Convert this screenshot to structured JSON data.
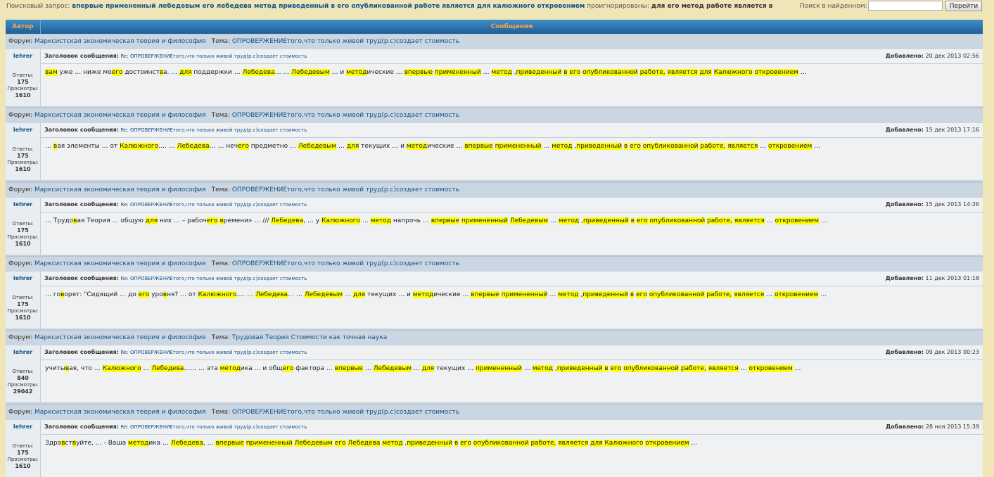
{
  "search": {
    "label": "Поисковый запрос:",
    "query": "впервые примененный лебедевым его лебедева метод приведенный в его опубликованной работе является для калюжного откровением",
    "ignored_label": "проигнорированы:",
    "ignored_words": "для его метод работе является в",
    "find_label": "Поиск в найденном:",
    "find_value": "",
    "go_label": "Перейти"
  },
  "columns": {
    "author": "Автор",
    "message": "Сообщение"
  },
  "labels": {
    "forum": "Форум:",
    "topic": "Тема:",
    "subject": "Заголовок сообщения:",
    "added": "Добавлено:",
    "replies": "Ответы:",
    "views": "Просмотры:"
  },
  "results": [
    {
      "forum": "Марксистская экономическая теория и философия",
      "topic": "ОПРОВЕРЖЕНИЕтого,что только живой труд(р.с)создает стоимость",
      "author": "lehrer",
      "replies": "175",
      "views": "1610",
      "subject": "Re: ОПРОВЕРЖЕНИЕтого,что только живой труд(р.с)создает стоимость",
      "date": "20 дек 2013 02:56",
      "body": [
        {
          "t": "вам",
          "h": true
        },
        {
          "t": " уже … ниже мо"
        },
        {
          "t": "его",
          "h": true
        },
        {
          "t": " достоинст"
        },
        {
          "t": "в",
          "h": true
        },
        {
          "t": "а. … "
        },
        {
          "t": "для",
          "h": true
        },
        {
          "t": " поддержки … "
        },
        {
          "t": "Лебедева",
          "h": true
        },
        {
          "t": "… … "
        },
        {
          "t": "Лебедевым",
          "h": true
        },
        {
          "t": " … и "
        },
        {
          "t": "метод",
          "h": true
        },
        {
          "t": "ические … "
        },
        {
          "t": "впервые",
          "h": true
        },
        {
          "t": " "
        },
        {
          "t": "примененный",
          "h": true
        },
        {
          "t": " … "
        },
        {
          "t": "метод",
          "h": true
        },
        {
          "t": " ,"
        },
        {
          "t": "приведенный",
          "h": true
        },
        {
          "t": " "
        },
        {
          "t": "в",
          "h": true
        },
        {
          "t": " "
        },
        {
          "t": "его",
          "h": true
        },
        {
          "t": " "
        },
        {
          "t": "опубликованной",
          "h": true
        },
        {
          "t": " "
        },
        {
          "t": "работе,",
          "h": true
        },
        {
          "t": " "
        },
        {
          "t": "является",
          "h": true
        },
        {
          "t": " "
        },
        {
          "t": "для",
          "h": true
        },
        {
          "t": " "
        },
        {
          "t": "Калюжного",
          "h": true
        },
        {
          "t": " "
        },
        {
          "t": "откровением",
          "h": true
        },
        {
          "t": " …"
        }
      ]
    },
    {
      "forum": "Марксистская экономическая теория и философия",
      "topic": "ОПРОВЕРЖЕНИЕтого,что только живой труд(р.с)создает стоимость",
      "author": "lehrer",
      "replies": "175",
      "views": "1610",
      "subject": "Re: ОПРОВЕРЖЕНИЕтого,что только живой труд(р.с)создает стоимость",
      "date": "15 дек 2013 17:16",
      "body": [
        {
          "t": "… "
        },
        {
          "t": "в",
          "h": true
        },
        {
          "t": "ая элементы … от "
        },
        {
          "t": "Калюжного",
          "h": true
        },
        {
          "t": "…. … "
        },
        {
          "t": "Лебедева",
          "h": true
        },
        {
          "t": "… … неч"
        },
        {
          "t": "его",
          "h": true
        },
        {
          "t": " предметно … "
        },
        {
          "t": "Лебедевым",
          "h": true
        },
        {
          "t": " … "
        },
        {
          "t": "для",
          "h": true
        },
        {
          "t": " текущих … и "
        },
        {
          "t": "метод",
          "h": true
        },
        {
          "t": "ические … "
        },
        {
          "t": "впервые",
          "h": true
        },
        {
          "t": " "
        },
        {
          "t": "примененный",
          "h": true
        },
        {
          "t": " … "
        },
        {
          "t": "метод",
          "h": true
        },
        {
          "t": " ,"
        },
        {
          "t": "приведенный",
          "h": true
        },
        {
          "t": " "
        },
        {
          "t": "в",
          "h": true
        },
        {
          "t": " "
        },
        {
          "t": "его",
          "h": true
        },
        {
          "t": " "
        },
        {
          "t": "опубликованной",
          "h": true
        },
        {
          "t": " "
        },
        {
          "t": "работе,",
          "h": true
        },
        {
          "t": " "
        },
        {
          "t": "является",
          "h": true
        },
        {
          "t": " … "
        },
        {
          "t": "откровением",
          "h": true
        },
        {
          "t": " …"
        }
      ]
    },
    {
      "forum": "Марксистская экономическая теория и философия",
      "topic": "ОПРОВЕРЖЕНИЕтого,что только живой труд(р.с)создает стоимость",
      "author": "lehrer",
      "replies": "175",
      "views": "1610",
      "subject": "Re: ОПРОВЕРЖЕНИЕтого,что только живой труд(р.с)создает стоимость",
      "date": "15 дек 2013 14:26",
      "body": [
        {
          "t": "… Трудо"
        },
        {
          "t": "в",
          "h": true
        },
        {
          "t": "ая Теория … общую "
        },
        {
          "t": "для",
          "h": true
        },
        {
          "t": " них … – рабоч"
        },
        {
          "t": "его",
          "h": true
        },
        {
          "t": " "
        },
        {
          "t": "в",
          "h": true
        },
        {
          "t": "ремени» … /// "
        },
        {
          "t": "Лебедева",
          "h": true
        },
        {
          "t": ", … у "
        },
        {
          "t": "Калюжного",
          "h": true
        },
        {
          "t": " … "
        },
        {
          "t": "метод",
          "h": true
        },
        {
          "t": " напрочь … "
        },
        {
          "t": "впервые",
          "h": true
        },
        {
          "t": " "
        },
        {
          "t": "примененный",
          "h": true
        },
        {
          "t": " "
        },
        {
          "t": "Лебедевым",
          "h": true
        },
        {
          "t": " … "
        },
        {
          "t": "метод",
          "h": true
        },
        {
          "t": " ,"
        },
        {
          "t": "приведенный",
          "h": true
        },
        {
          "t": " "
        },
        {
          "t": "в",
          "h": true
        },
        {
          "t": " "
        },
        {
          "t": "его",
          "h": true
        },
        {
          "t": " "
        },
        {
          "t": "опубликованной",
          "h": true
        },
        {
          "t": " "
        },
        {
          "t": "работе,",
          "h": true
        },
        {
          "t": " "
        },
        {
          "t": "является",
          "h": true
        },
        {
          "t": " … "
        },
        {
          "t": "откровением",
          "h": true
        },
        {
          "t": " …"
        }
      ]
    },
    {
      "forum": "Марксистская экономическая теория и философия",
      "topic": "ОПРОВЕРЖЕНИЕтого,что только живой труд(р.с)создает стоимость",
      "author": "lehrer",
      "replies": "175",
      "views": "1610",
      "subject": "Re: ОПРОВЕРЖЕНИЕтого,что только живой труд(р.с)создает стоимость",
      "date": "11 дек 2013 01:18",
      "body": [
        {
          "t": "… го"
        },
        {
          "t": "в",
          "h": true
        },
        {
          "t": "орят: \"Сидящий … до "
        },
        {
          "t": "его",
          "h": true
        },
        {
          "t": " уро"
        },
        {
          "t": "в",
          "h": true
        },
        {
          "t": "ня? … от "
        },
        {
          "t": "Калюжного",
          "h": true
        },
        {
          "t": "…. … "
        },
        {
          "t": "Лебедева",
          "h": true
        },
        {
          "t": "… … "
        },
        {
          "t": "Лебедевым",
          "h": true
        },
        {
          "t": " … "
        },
        {
          "t": "для",
          "h": true
        },
        {
          "t": " текущих … и "
        },
        {
          "t": "метод",
          "h": true
        },
        {
          "t": "ические … "
        },
        {
          "t": "впервые",
          "h": true
        },
        {
          "t": " "
        },
        {
          "t": "примененный",
          "h": true
        },
        {
          "t": " … "
        },
        {
          "t": "метод",
          "h": true
        },
        {
          "t": " ,"
        },
        {
          "t": "приведенный",
          "h": true
        },
        {
          "t": " "
        },
        {
          "t": "в",
          "h": true
        },
        {
          "t": " "
        },
        {
          "t": "его",
          "h": true
        },
        {
          "t": " "
        },
        {
          "t": "опубликованной",
          "h": true
        },
        {
          "t": " "
        },
        {
          "t": "работе,",
          "h": true
        },
        {
          "t": " "
        },
        {
          "t": "является",
          "h": true
        },
        {
          "t": " … "
        },
        {
          "t": "откровением",
          "h": true
        },
        {
          "t": " …"
        }
      ]
    },
    {
      "forum": "Марксистская экономическая теория и философия",
      "topic": "Трудовая Теория Стоимости как точная наука",
      "author": "lehrer",
      "replies": "840",
      "views": "29042",
      "subject": "Re: ОПРОВЕРЖЕНИЕтого,что только живой труд(р.с)создает стоимость",
      "date": "09 дек 2013 00:23",
      "body": [
        {
          "t": "учиты"
        },
        {
          "t": "в",
          "h": true
        },
        {
          "t": "ая, что … "
        },
        {
          "t": "Калюжного",
          "h": true
        },
        {
          "t": " … "
        },
        {
          "t": "Лебедева",
          "h": true
        },
        {
          "t": "…… … эта "
        },
        {
          "t": "метод",
          "h": true
        },
        {
          "t": "ика … и общ"
        },
        {
          "t": "его",
          "h": true
        },
        {
          "t": " фактора … "
        },
        {
          "t": "впервые",
          "h": true
        },
        {
          "t": " … "
        },
        {
          "t": "Лебедевым",
          "h": true
        },
        {
          "t": " … "
        },
        {
          "t": "для",
          "h": true
        },
        {
          "t": " текущих … "
        },
        {
          "t": "примененный",
          "h": true
        },
        {
          "t": " … "
        },
        {
          "t": "метод",
          "h": true
        },
        {
          "t": " ,"
        },
        {
          "t": "приведенный",
          "h": true
        },
        {
          "t": " "
        },
        {
          "t": "в",
          "h": true
        },
        {
          "t": " "
        },
        {
          "t": "его",
          "h": true
        },
        {
          "t": " "
        },
        {
          "t": "опубликованной",
          "h": true
        },
        {
          "t": " "
        },
        {
          "t": "работе,",
          "h": true
        },
        {
          "t": " "
        },
        {
          "t": "является",
          "h": true
        },
        {
          "t": " … "
        },
        {
          "t": "откровением",
          "h": true
        },
        {
          "t": " …"
        }
      ]
    },
    {
      "forum": "Марксистская экономическая теория и философия",
      "topic": "ОПРОВЕРЖЕНИЕтого,что только живой труд(р.с)создает стоимость",
      "author": "lehrer",
      "replies": "175",
      "views": "1610",
      "subject": "Re: ОПРОВЕРЖЕНИЕтого,что только живой труд(р.с)создает стоимость",
      "date": "28 ноя 2013 15:39",
      "body": [
        {
          "t": "Здра"
        },
        {
          "t": "в",
          "h": true
        },
        {
          "t": "ст"
        },
        {
          "t": "в",
          "h": true
        },
        {
          "t": "уйте, … - Ваша "
        },
        {
          "t": "метод",
          "h": true
        },
        {
          "t": "ика … "
        },
        {
          "t": "Лебедева",
          "h": true
        },
        {
          "t": ", … "
        },
        {
          "t": "впервые",
          "h": true
        },
        {
          "t": " "
        },
        {
          "t": "примененный",
          "h": true
        },
        {
          "t": " "
        },
        {
          "t": "Лебедевым",
          "h": true
        },
        {
          "t": " "
        },
        {
          "t": "его",
          "h": true
        },
        {
          "t": " "
        },
        {
          "t": "Лебедева",
          "h": true
        },
        {
          "t": " "
        },
        {
          "t": "метод",
          "h": true
        },
        {
          "t": " ,"
        },
        {
          "t": "приведенный",
          "h": true
        },
        {
          "t": " "
        },
        {
          "t": "в",
          "h": true
        },
        {
          "t": " "
        },
        {
          "t": "его",
          "h": true
        },
        {
          "t": " "
        },
        {
          "t": "опубликованной",
          "h": true
        },
        {
          "t": " "
        },
        {
          "t": "работе,",
          "h": true
        },
        {
          "t": " "
        },
        {
          "t": "является",
          "h": true
        },
        {
          "t": " "
        },
        {
          "t": "для",
          "h": true
        },
        {
          "t": " "
        },
        {
          "t": "Калюжного",
          "h": true
        },
        {
          "t": " "
        },
        {
          "t": "откровением",
          "h": true
        },
        {
          "t": " …"
        }
      ]
    }
  ]
}
